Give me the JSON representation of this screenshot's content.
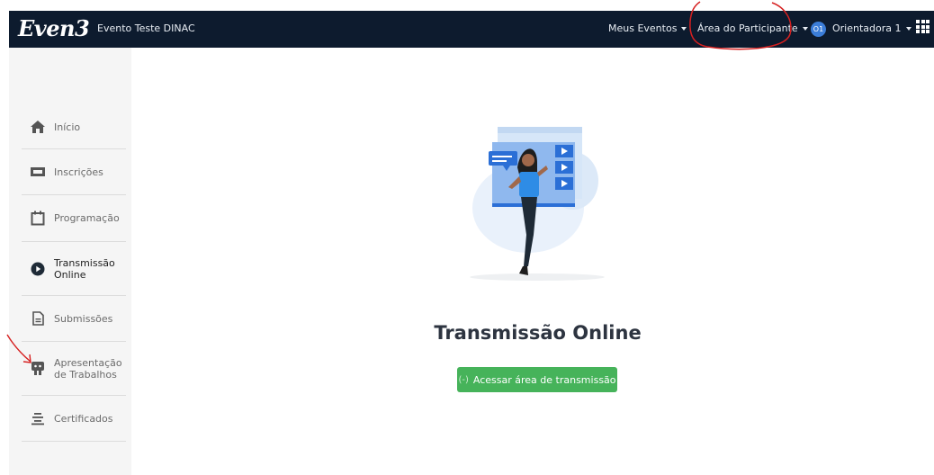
{
  "header": {
    "logo": "Even3",
    "event_name": "Evento Teste DINAC",
    "nav": {
      "my_events": "Meus Eventos",
      "participant_area": "Área do Participante",
      "user_initials": "O1",
      "user_name": "Orientadora 1"
    }
  },
  "sidebar": {
    "items": [
      {
        "label": "Início",
        "icon": "home-icon"
      },
      {
        "label": "Inscrições",
        "icon": "ticket-icon"
      },
      {
        "label": "Programação",
        "icon": "calendar-icon"
      },
      {
        "label": "Transmissão Online",
        "icon": "play-icon",
        "active": true
      },
      {
        "label": "Submissões",
        "icon": "document-icon"
      },
      {
        "label": "Apresentação de Trabalhos",
        "icon": "presentation-icon"
      },
      {
        "label": "Certificados",
        "icon": "certificate-icon"
      }
    ]
  },
  "main": {
    "title": "Transmissão Online",
    "cta_label": "Acessar área de transmissão",
    "cta_icon": "(-)"
  },
  "colors": {
    "topbar": "#0d1b2e",
    "cta": "#46b35a",
    "avatar": "#3b7dd8",
    "annotation": "#d62020"
  }
}
